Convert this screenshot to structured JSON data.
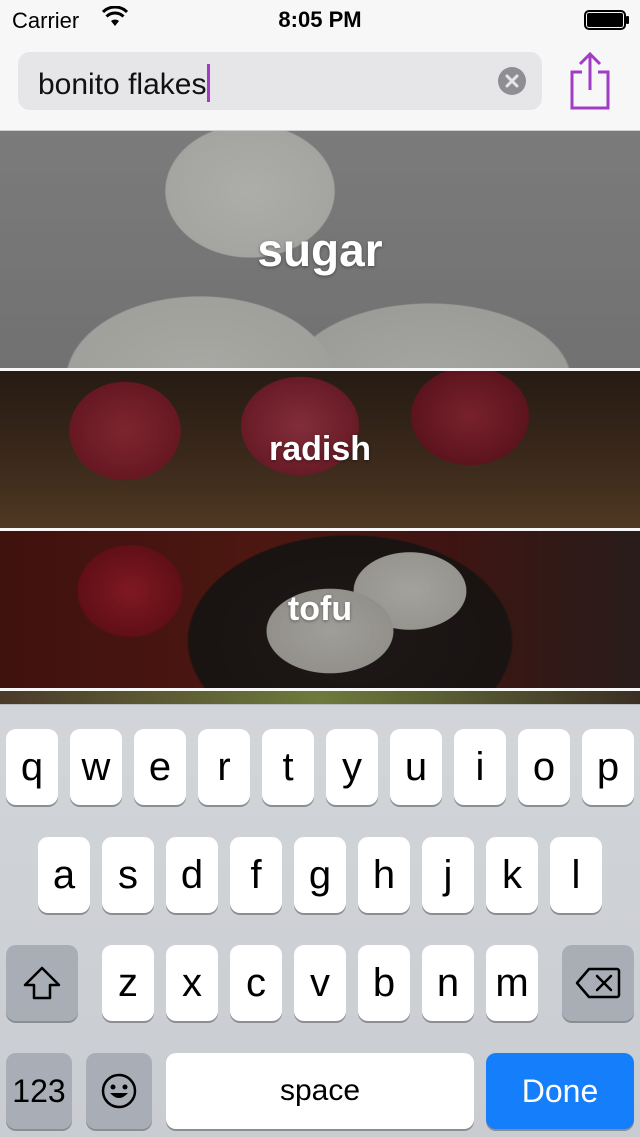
{
  "status_bar": {
    "carrier": "Carrier",
    "time": "8:05 PM"
  },
  "search": {
    "value": "bonito flakes",
    "cursor_color": "#a23cc4",
    "clear_icon": "clear-x-circle-icon",
    "share_icon": "share-icon",
    "share_color": "#a23cc4"
  },
  "items": [
    {
      "label": "sugar"
    },
    {
      "label": "radish"
    },
    {
      "label": "tofu"
    }
  ],
  "keyboard": {
    "row1": [
      "q",
      "w",
      "e",
      "r",
      "t",
      "y",
      "u",
      "i",
      "o",
      "p"
    ],
    "row2": [
      "a",
      "s",
      "d",
      "f",
      "g",
      "h",
      "j",
      "k",
      "l"
    ],
    "row3": [
      "z",
      "x",
      "c",
      "v",
      "b",
      "n",
      "m"
    ],
    "num_label": "123",
    "space_label": "space",
    "done_label": "Done",
    "done_color": "#157efb"
  }
}
